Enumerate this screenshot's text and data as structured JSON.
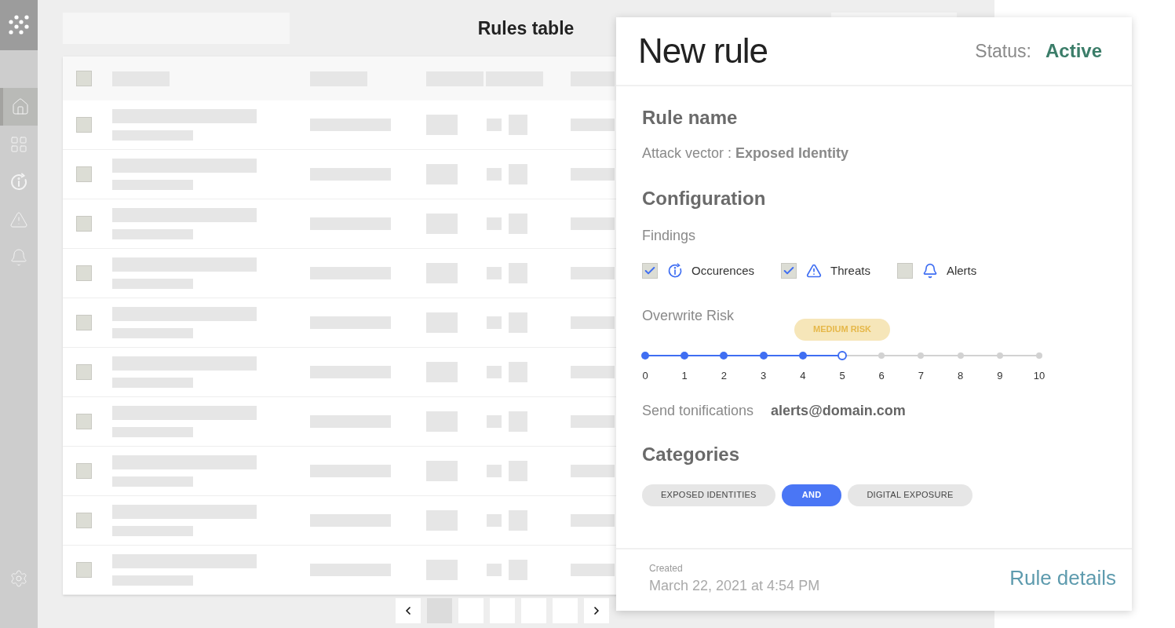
{
  "sidebar": {
    "items": [
      {
        "kind": "home",
        "selected": true
      },
      {
        "kind": "grid",
        "selected": false
      },
      {
        "kind": "occurrences",
        "selected": false
      },
      {
        "kind": "warning",
        "selected": false
      },
      {
        "kind": "bell",
        "selected": false
      }
    ]
  },
  "header": {
    "title": "Rules table"
  },
  "table": {
    "header_checked": false,
    "rows": [
      {
        "checked": false
      },
      {
        "checked": false
      },
      {
        "checked": false
      },
      {
        "checked": false
      },
      {
        "checked": false
      },
      {
        "checked": false
      },
      {
        "checked": false
      },
      {
        "checked": false
      },
      {
        "checked": false
      },
      {
        "checked": false
      }
    ]
  },
  "pagination": {
    "pages": [
      {
        "selected": true
      },
      {
        "selected": false
      },
      {
        "selected": false
      },
      {
        "selected": false
      },
      {
        "selected": false
      }
    ]
  },
  "panel": {
    "title": "New rule",
    "status_label": "Status:",
    "status_value": "Active",
    "rule_name_heading": "Rule name",
    "attack_vector": "Attack vector : **Exposed Identity**",
    "configuration_heading": "Configuration",
    "findings_label": "Findings",
    "findings": [
      {
        "kind": "occurrences",
        "label": "Occurences",
        "checked": true
      },
      {
        "kind": "threats",
        "label": "Threats",
        "checked": true
      },
      {
        "kind": "alerts",
        "label": "Alerts",
        "checked": false
      }
    ],
    "risk_label": "Overwrite Risk",
    "risk_badge": "MEDIUM RISK",
    "risk_level": {
      "level": 0.5
    },
    "risk_ticks": [
      "0",
      "1",
      "2",
      "3",
      "4",
      "5",
      "6",
      "7",
      "8",
      "9",
      "10"
    ],
    "notifications_label": "Send tonifications",
    "notifications_value": "alerts@domain.com",
    "categories_heading": "Categories",
    "chips": [
      {
        "kind": "category",
        "label": "EXPOSED IDENTITIES"
      },
      {
        "kind": "operator",
        "label": "AND"
      },
      {
        "kind": "category",
        "label": "DIGITAL EXPOSURE"
      }
    ],
    "created_label": "Created",
    "created_value": "March 22, 2021 at 4:54 PM",
    "details_link": "Rule details"
  }
}
